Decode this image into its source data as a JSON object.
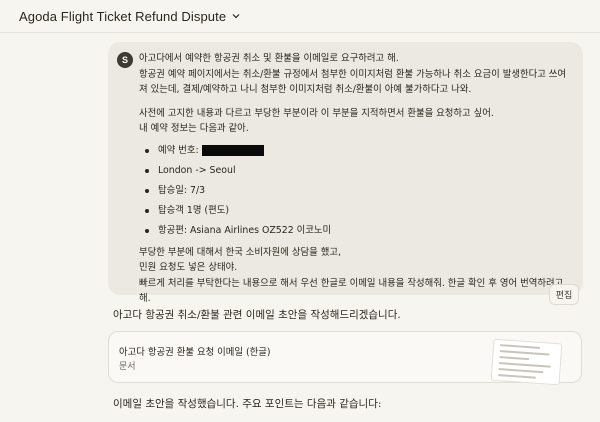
{
  "header": {
    "title": "Agoda Flight Ticket Refund Dispute"
  },
  "user_message": {
    "avatar_initial": "S",
    "para1_line1": "아고다에서 예약한 항공권 취소 및 환불을 이메일로 요구하려고 해.",
    "para1_line2": "항공권 예약 페이지에서는 취소/환불 규정에서 첨부한 이미지처럼 환불 가능하나 취소 요금이 발생한다고 쓰여져 있는데, 결제/예약하고 나니 첨부한 이미지처럼 취소/환불이 아예 불가하다고 나와.",
    "para2_line1": "사전에 고지한 내용과 다르고 부당한 부분이라 이 부분을 지적하면서 환불을 요청하고 싶어.",
    "para2_line2": "내 예약 정보는 다음과 같아.",
    "items": [
      {
        "label": "예약 번호:"
      },
      {
        "label": "London -> Seoul"
      },
      {
        "label": "탑승일: 7/3"
      },
      {
        "label": "탑승객 1명 (편도)"
      },
      {
        "label": "항공편: Asiana Airlines OZ522 이코노미"
      }
    ],
    "para3_line1": "부당한 부분에 대해서 한국 소비자원에 상담을 했고,",
    "para3_line2": "민원 요청도 넣은 상태야.",
    "para3_line3": "빠르게 처리를 부탁한다는 내용으로 해서 우선 한글로 이메일 내용을 작성해줘. 한글 확인 후 영어 번역하려고  해."
  },
  "edit_button": {
    "label": "편집"
  },
  "assistant": {
    "reply1": "아고다 항공권 취소/환불 관련 이메일 초안을 작성해드리겠습니다.",
    "artifact": {
      "title": "아고다 항공권 환불 요청 이메일 (한글)",
      "type_label": "문서"
    },
    "reply2": "이메일 초안을 작성했습니다. 주요 포인트는 다음과 같습니다:"
  },
  "icons": {
    "title_dropdown": "chevron-down-icon"
  },
  "colors": {
    "background": "#f6f5f0",
    "bubble": "#ebe9e1",
    "avatar": "#3d3a32"
  }
}
